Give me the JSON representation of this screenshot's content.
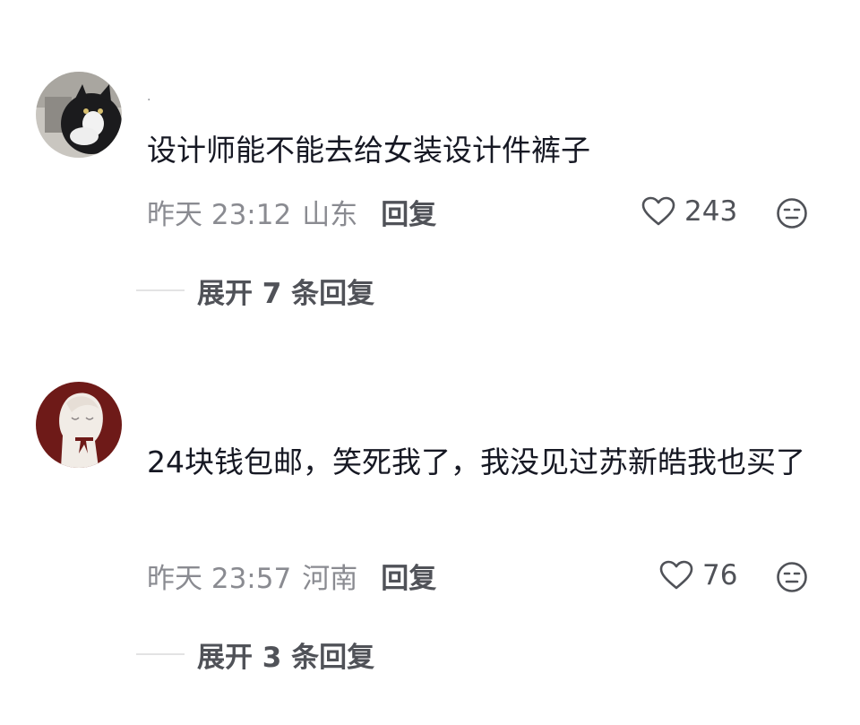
{
  "comments": [
    {
      "username": "·",
      "content": "设计师能不能去给女装设计件裤子",
      "time": "昨天 23:12",
      "location": "山东",
      "reply_label": "回复",
      "likes": "243",
      "expand_label": "展开 7 条回复"
    },
    {
      "username": "",
      "content": "24块钱包邮，笑死我了，我没见过苏新皓我也买了",
      "time": "昨天 23:57",
      "location": "河南",
      "reply_label": "回复",
      "likes": "76",
      "expand_label": "展开 3 条回复"
    }
  ],
  "colors": {
    "text_primary": "#161823",
    "text_secondary": "#8a8b91",
    "text_action": "#505258",
    "divider": "#e3e3e4",
    "avatar2_bg": "#6e1a18"
  },
  "icons": {
    "like": "heart-outline-icon",
    "dislike": "neutral-face-icon"
  }
}
